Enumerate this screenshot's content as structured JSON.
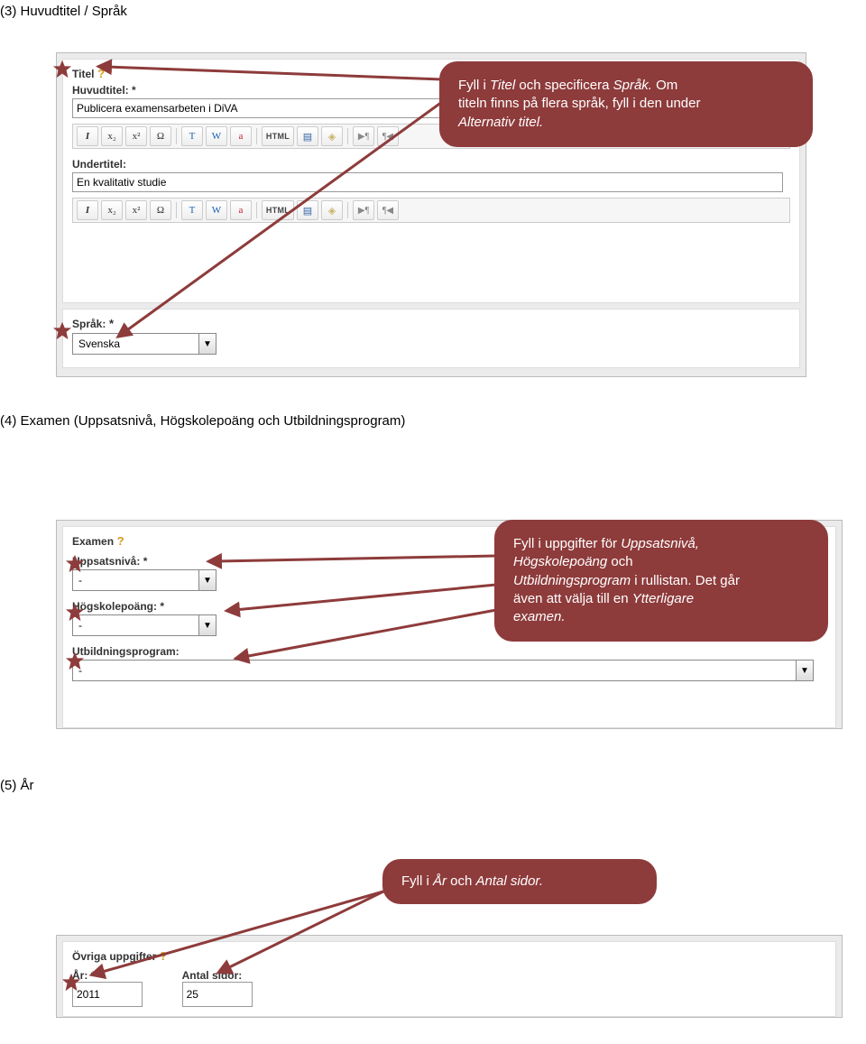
{
  "headings": {
    "s3": "(3) Huvudtitel / Språk",
    "s4": "(4) Examen (Uppsatsnivå, Högskolepoäng och Utbildningsprogram)",
    "s5": "(5) År"
  },
  "titel": {
    "label": "Titel",
    "help": "?",
    "huvudtitel_label": "Huvudtitel:",
    "huvudtitel_req": "*",
    "huvudtitel_value": "Publicera examensarbeten i DiVA",
    "undertitel_label": "Undertitel:",
    "undertitel_value": "En kvalitativ studie"
  },
  "sprak": {
    "label": "Språk:",
    "req": "*",
    "value": "Svenska"
  },
  "toolbar": {
    "bold": "I",
    "sub": "x₂",
    "sup": "x²",
    "omega": "Ω",
    "paste_t": "T",
    "paste_w": "W",
    "paste_a": "a",
    "html": "HTML",
    "src": "▤",
    "clear": "◈",
    "pil1": "▶¶",
    "pil2": "¶◀"
  },
  "callout_titel": {
    "l1a": "Fyll i ",
    "l1b": "Titel",
    "l1c": " och specificera ",
    "l1d": "Språk.",
    "l1e": " Om",
    "l2a": "titeln finns på flera språk, fyll i den under ",
    "l3a": "Alternativ titel."
  },
  "examen": {
    "label": "Examen",
    "help": "?",
    "uppsatsniva_label": "Uppsatsnivå:",
    "uppsatsniva_req": "*",
    "uppsatsniva_value": "-",
    "hogskolepoang_label": "Högskolepoäng:",
    "hogskolepoang_req": "*",
    "hogskolepoang_value": "-",
    "utbildningsprogram_label": "Utbildningsprogram:",
    "utbildningsprogram_value": "-"
  },
  "callout_examen": {
    "l1a": "Fyll i  uppgifter för ",
    "l1b": "Uppsatsnivå,",
    "l2a": "Högskolepoäng",
    "l2b": " och",
    "l3a": "Utbildningsprogram",
    "l3b": " i rullistan.",
    "l3c": "  Det går",
    "l4a": "även att välja till en ",
    "l4b": "Ytterligare",
    "l5a": "examen."
  },
  "ovrigt": {
    "label": "Övriga uppgifter",
    "help": "?",
    "ar_label": "År:",
    "ar_req": "*",
    "ar_value": "2011",
    "sidor_label": "Antal sidor:",
    "sidor_value": "25"
  },
  "callout_ar": {
    "l1a": "Fyll i  ",
    "l1b": "År ",
    "l1c": " och ",
    "l1d": "Antal sidor."
  }
}
